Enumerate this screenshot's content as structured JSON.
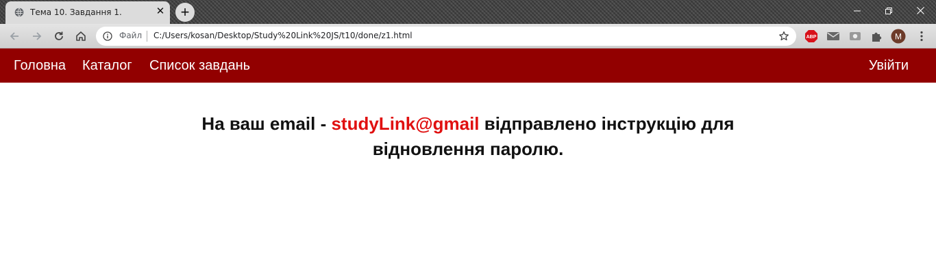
{
  "browser": {
    "tab_title": "Тема 10. Завдання 1.",
    "new_tab_label": "+",
    "close_label": "✕",
    "address": {
      "scheme_label": "Файл",
      "url": "C:/Users/kosan/Desktop/Study%20Link%20JS/t10/done/z1.html"
    },
    "profile_initial": "M",
    "abp_label": "ABP"
  },
  "nav": {
    "items": [
      "Головна",
      "Каталог",
      "Список завдань"
    ],
    "logout": "Увійти"
  },
  "message": {
    "prefix": "На ваш email - ",
    "email": "studyLink@gmail",
    "suffix": " відправлено інструкцію для відновлення паролю."
  },
  "colors": {
    "navbar": "#920000",
    "email": "#e01010",
    "tab": "#dcdcdc"
  }
}
